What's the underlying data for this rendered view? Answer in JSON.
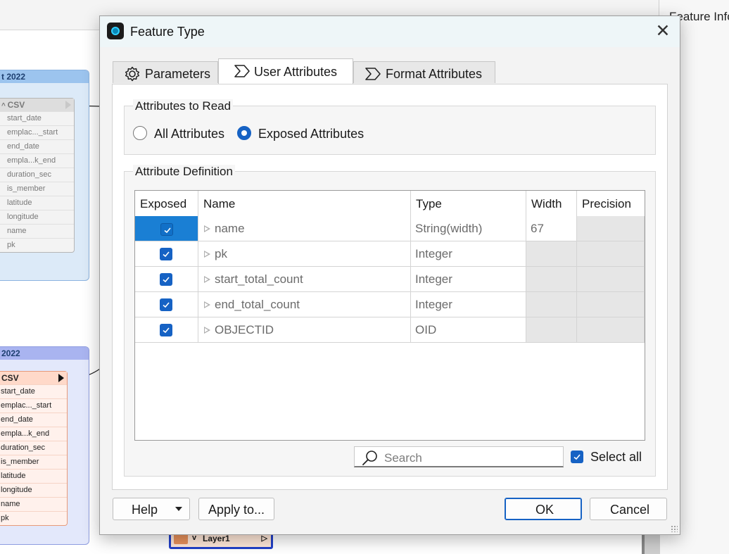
{
  "background": {
    "right_panel_title": "Feature Info",
    "bookmark1_title": "t 2022",
    "bookmark2_title": "2022",
    "reader1": {
      "name": "CSV",
      "attributes": [
        "start_date",
        "emplac..._start",
        "end_date",
        "empla...k_end",
        "duration_sec",
        "is_member",
        "latitude",
        "longitude",
        "name",
        "pk"
      ]
    },
    "reader2": {
      "name": "CSV",
      "attributes": [
        "start_date",
        "emplac..._start",
        "end_date",
        "empla...k_end",
        "duration_sec",
        "is_member",
        "latitude",
        "longitude",
        "name",
        "pk"
      ]
    },
    "layer_node_label": "Layer1"
  },
  "dialog": {
    "title": "Feature Type",
    "close_glyph": "✕",
    "tabs": [
      {
        "label": "Parameters",
        "icon": "gear-icon",
        "active": false
      },
      {
        "label": "User Attributes",
        "icon": "sigma-icon",
        "active": true
      },
      {
        "label": "Format Attributes",
        "icon": "sigma-icon",
        "active": false
      }
    ],
    "read_group": {
      "title": "Attributes to Read",
      "options": [
        {
          "label": "All Attributes",
          "selected": false
        },
        {
          "label": "Exposed Attributes",
          "selected": true
        }
      ]
    },
    "definition_group": {
      "title": "Attribute Definition",
      "columns": [
        "Exposed",
        "Name",
        "Type",
        "Width",
        "Precision"
      ],
      "rows": [
        {
          "exposed": true,
          "name": "name",
          "type": "String(width)",
          "width": "67",
          "precision": "",
          "selected": true
        },
        {
          "exposed": true,
          "name": "pk",
          "type": "Integer",
          "width": "",
          "precision": "",
          "selected": false
        },
        {
          "exposed": true,
          "name": "start_total_count",
          "type": "Integer",
          "width": "",
          "precision": "",
          "selected": false
        },
        {
          "exposed": true,
          "name": "end_total_count",
          "type": "Integer",
          "width": "",
          "precision": "",
          "selected": false
        },
        {
          "exposed": true,
          "name": "OBJECTID",
          "type": "OID",
          "width": "",
          "precision": "",
          "selected": false
        }
      ],
      "search_placeholder": "Search",
      "select_all_label": "Select all",
      "select_all_checked": true
    },
    "buttons": {
      "help": "Help",
      "apply": "Apply to...",
      "ok": "OK",
      "cancel": "Cancel"
    },
    "colors": {
      "accent": "#1662c4",
      "selected_row": "#1a7fd4",
      "titlebar": "#eef6f8"
    }
  }
}
